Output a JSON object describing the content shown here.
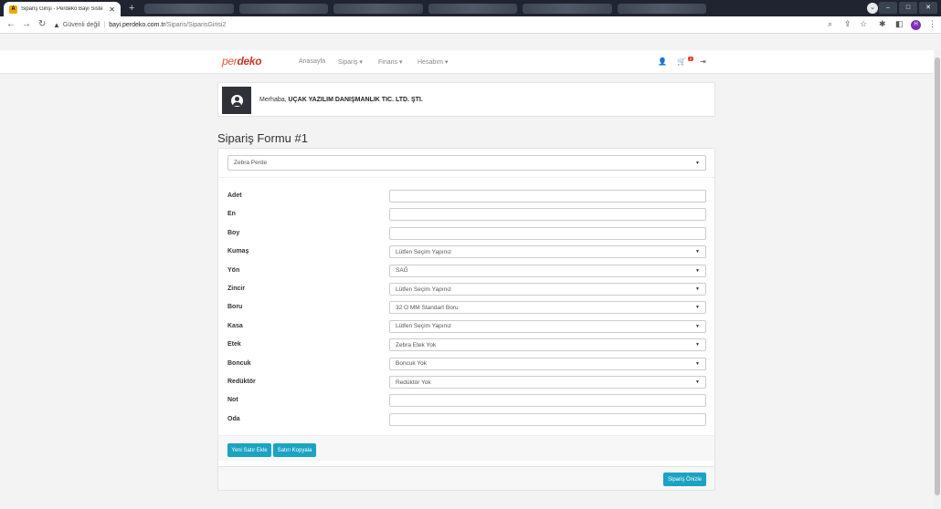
{
  "browser": {
    "active_tab_title": "Sipariş Girişi - Perdeko Bayi Siste",
    "security_label": "Güvenli değil",
    "url_host": "bayi.perdeko.com.tr",
    "url_path": "/Siparis/SiparisGirisi2",
    "profile_initial": "H"
  },
  "nav": {
    "logo_part1": "per",
    "logo_part2": "deko",
    "links": [
      "Anasayfa",
      "Sipariş ▾",
      "Finans ▾",
      "Hesabım ▾"
    ],
    "cart_count": "0"
  },
  "welcome": {
    "greeting": "Merhaba, ",
    "company": "UÇAK YAZILIM DANIŞMANLIK TIC. LTD. ŞTI."
  },
  "form": {
    "title": "Sipariş Formu #1",
    "product_type": "Zebra Perde",
    "fields": [
      {
        "label": "Adet",
        "kind": "input",
        "value": ""
      },
      {
        "label": "En",
        "kind": "input",
        "value": ""
      },
      {
        "label": "Boy",
        "kind": "input",
        "value": ""
      },
      {
        "label": "Kumaş",
        "kind": "select",
        "value": "Lütfen Seçim Yapınız"
      },
      {
        "label": "Yön",
        "kind": "select",
        "value": "SAĞ"
      },
      {
        "label": "Zincir",
        "kind": "select",
        "value": "Lütfen Seçim Yapınız"
      },
      {
        "label": "Boru",
        "kind": "select",
        "value": "32 O MM Standart Boru"
      },
      {
        "label": "Kasa",
        "kind": "select",
        "value": "Lütfen Seçim Yapınız"
      },
      {
        "label": "Etek",
        "kind": "select",
        "value": "Zebra Etek Yok"
      },
      {
        "label": "Boncuk",
        "kind": "select",
        "value": "Boncuk Yok"
      },
      {
        "label": "Redüktör",
        "kind": "select",
        "value": "Redüktör Yok"
      },
      {
        "label": "Not",
        "kind": "input",
        "value": ""
      },
      {
        "label": "Oda",
        "kind": "input",
        "value": ""
      }
    ],
    "add_row_label": "Yeni Satır Ekle",
    "copy_row_label": "Satırı Kopyala",
    "preview_label": "Sipariş Önizle"
  },
  "colors": {
    "accent": "#1aa3c2",
    "logo": "#e8553d"
  }
}
